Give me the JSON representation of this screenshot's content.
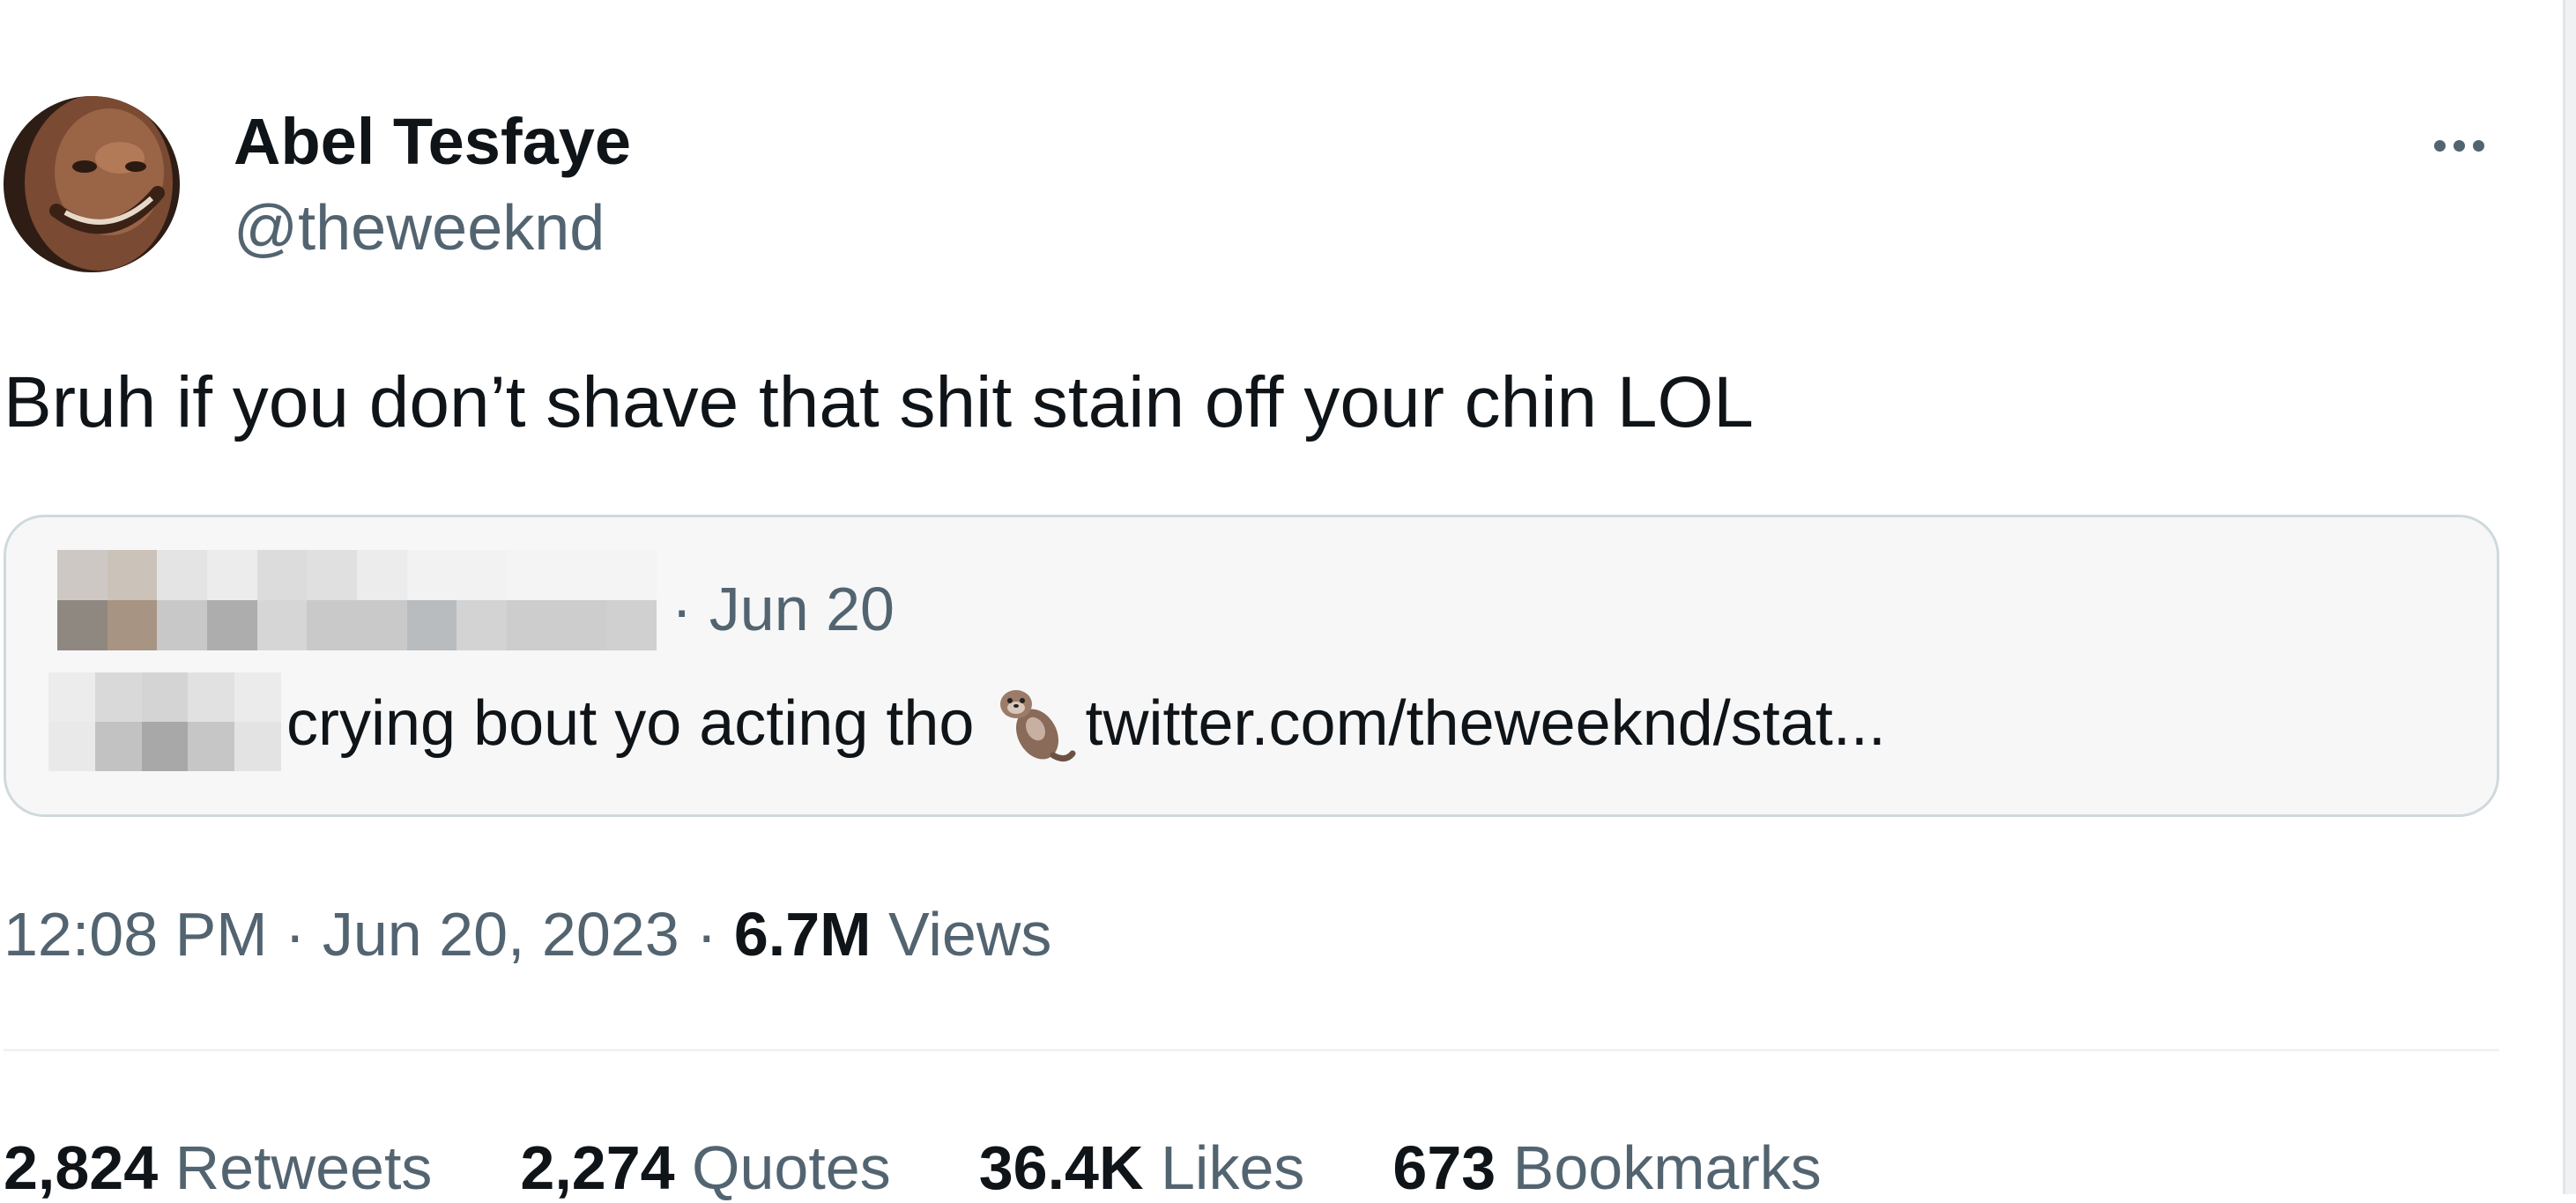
{
  "author": {
    "display_name": "Abel Tesfaye",
    "handle": "@theweeknd"
  },
  "tweet": {
    "text": "Bruh if you don’t shave that shit stain off your chin LOL"
  },
  "quoted_tweet": {
    "date": "· Jun 20",
    "text": "crying bout yo acting tho",
    "emoji_icon": "otter-icon",
    "link": "twitter.com/theweeknd/stat..."
  },
  "meta": {
    "time": "12:08 PM",
    "sep1": " · ",
    "date": "Jun 20, 2023",
    "sep2": " · ",
    "views_count": "6.7M",
    "views_label": "Views"
  },
  "stats": [
    {
      "count": "2,824",
      "label": "Retweets"
    },
    {
      "count": "2,274",
      "label": "Quotes"
    },
    {
      "count": "36.4K",
      "label": "Likes"
    },
    {
      "count": "673",
      "label": "Bookmarks"
    }
  ],
  "colors": {
    "primary_text": "#0f1419",
    "secondary_text": "#536471",
    "card_border": "#cfd9de",
    "card_bg": "#f7f7f7",
    "divider": "#eff3f4"
  }
}
